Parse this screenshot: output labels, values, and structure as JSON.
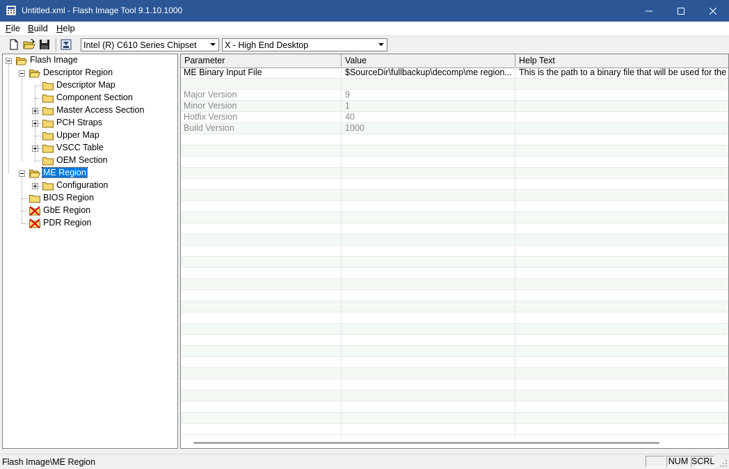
{
  "window": {
    "title": "Untitled.xml - Flash Image Tool 9.1.10.1000",
    "icons": {
      "app": "app-icon",
      "minimize": "minimize-icon",
      "maximize": "maximize-icon",
      "close": "close-icon"
    }
  },
  "menu": {
    "items": [
      "File",
      "Build",
      "Help"
    ]
  },
  "toolbar": {
    "icons": [
      "new-file-icon",
      "open-folder-icon",
      "save-icon",
      "build-image-icon"
    ],
    "chipset_value": "Intel (R) C610 Series Chipset",
    "platform_value": "X - High End Desktop"
  },
  "tree": {
    "root": "Flash Image",
    "descriptor_region": "Descriptor Region",
    "descriptor_map": "Descriptor Map",
    "component_section": "Component Section",
    "master_access_section": "Master Access Section",
    "pch_straps": "PCH Straps",
    "upper_map": "Upper Map",
    "vscc_table": "VSCC Table",
    "oem_section": "OEM Section",
    "me_region": "ME Region",
    "configuration": "Configuration",
    "bios_region": "BIOS Region",
    "gbe_region": "GbE Region",
    "pdr_region": "PDR Region"
  },
  "grid": {
    "headers": {
      "parameter": "Parameter",
      "value": "Value",
      "help": "Help Text"
    },
    "rows": [
      {
        "parameter": "ME Binary Input File",
        "value": "$SourceDir\\fullbackup\\decomp\\me region....",
        "help": "This is the path to a binary file that will be used for the M",
        "dim": false
      },
      {
        "parameter": "Major Version",
        "value": "9",
        "help": "",
        "dim": true
      },
      {
        "parameter": "Minor Version",
        "value": "1",
        "help": "",
        "dim": true
      },
      {
        "parameter": "Hotfix Version",
        "value": "40",
        "help": "",
        "dim": true
      },
      {
        "parameter": "Build Version",
        "value": "1000",
        "help": "",
        "dim": true
      }
    ]
  },
  "status": {
    "path": "Flash Image\\ME Region",
    "num": "NUM",
    "scrl": "SCRL"
  }
}
